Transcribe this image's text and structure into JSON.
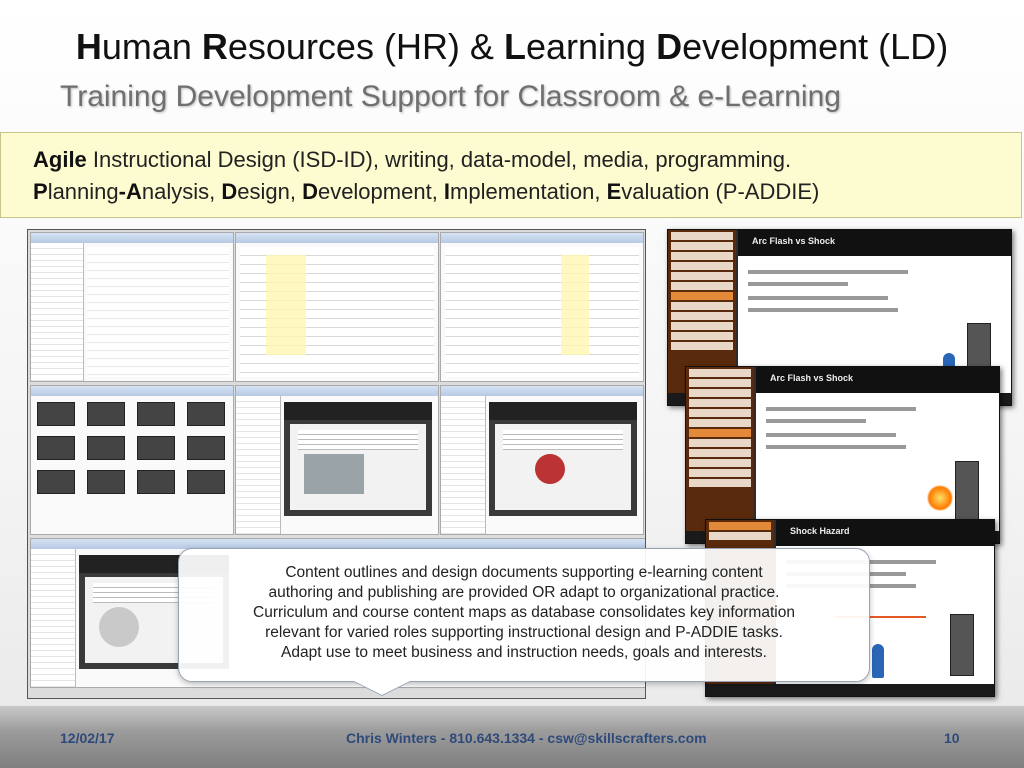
{
  "slide": {
    "title": {
      "p1_b": "H",
      "p1": "uman ",
      "p2_b": "R",
      "p2": "esources (HR) & ",
      "p3_b": "L",
      "p3": "earning ",
      "p4_b": "D",
      "p4": "evelopment (LD)"
    },
    "subtitle": "Training Development Support for Classroom & e-Learning",
    "callout": {
      "l1_b": "Agile",
      "l1": " Instructional Design (ISD-ID), writing, data-model, media, programming.",
      "l2": [
        {
          "b": "P",
          "t": "lanning"
        },
        {
          "b": "-A",
          "t": "nalysis, "
        },
        {
          "b": "D",
          "t": "esign, "
        },
        {
          "b": "D",
          "t": "evelopment, "
        },
        {
          "b": "I",
          "t": "mplementation, "
        },
        {
          "b": "E",
          "t": "valuation (P-ADDIE)"
        }
      ]
    },
    "overlay_lines": [
      "Content outlines and design documents supporting e-learning content",
      "authoring and publishing are provided OR adapt to organizational practice.",
      "Curriculum and course content maps as database consolidates key information",
      "relevant for varied roles supporting instructional design and P-ADDIE tasks.",
      "Adapt use to meet business and instruction needs, goals and interests."
    ],
    "elearning": {
      "slide1_title": "Arc Flash vs Shock",
      "slide2_title": "Arc Flash vs Shock",
      "slide3_title": "Shock Hazard"
    },
    "footer": {
      "date": "12/02/17",
      "contact": "Chris Winters - 810.643.1334 - csw@skillscrafters.com",
      "page": "10"
    },
    "colors": {
      "callout_bg": "#fdfbd0",
      "footer_text": "#2f4a7a",
      "subtitle": "#6f6f6f"
    }
  }
}
